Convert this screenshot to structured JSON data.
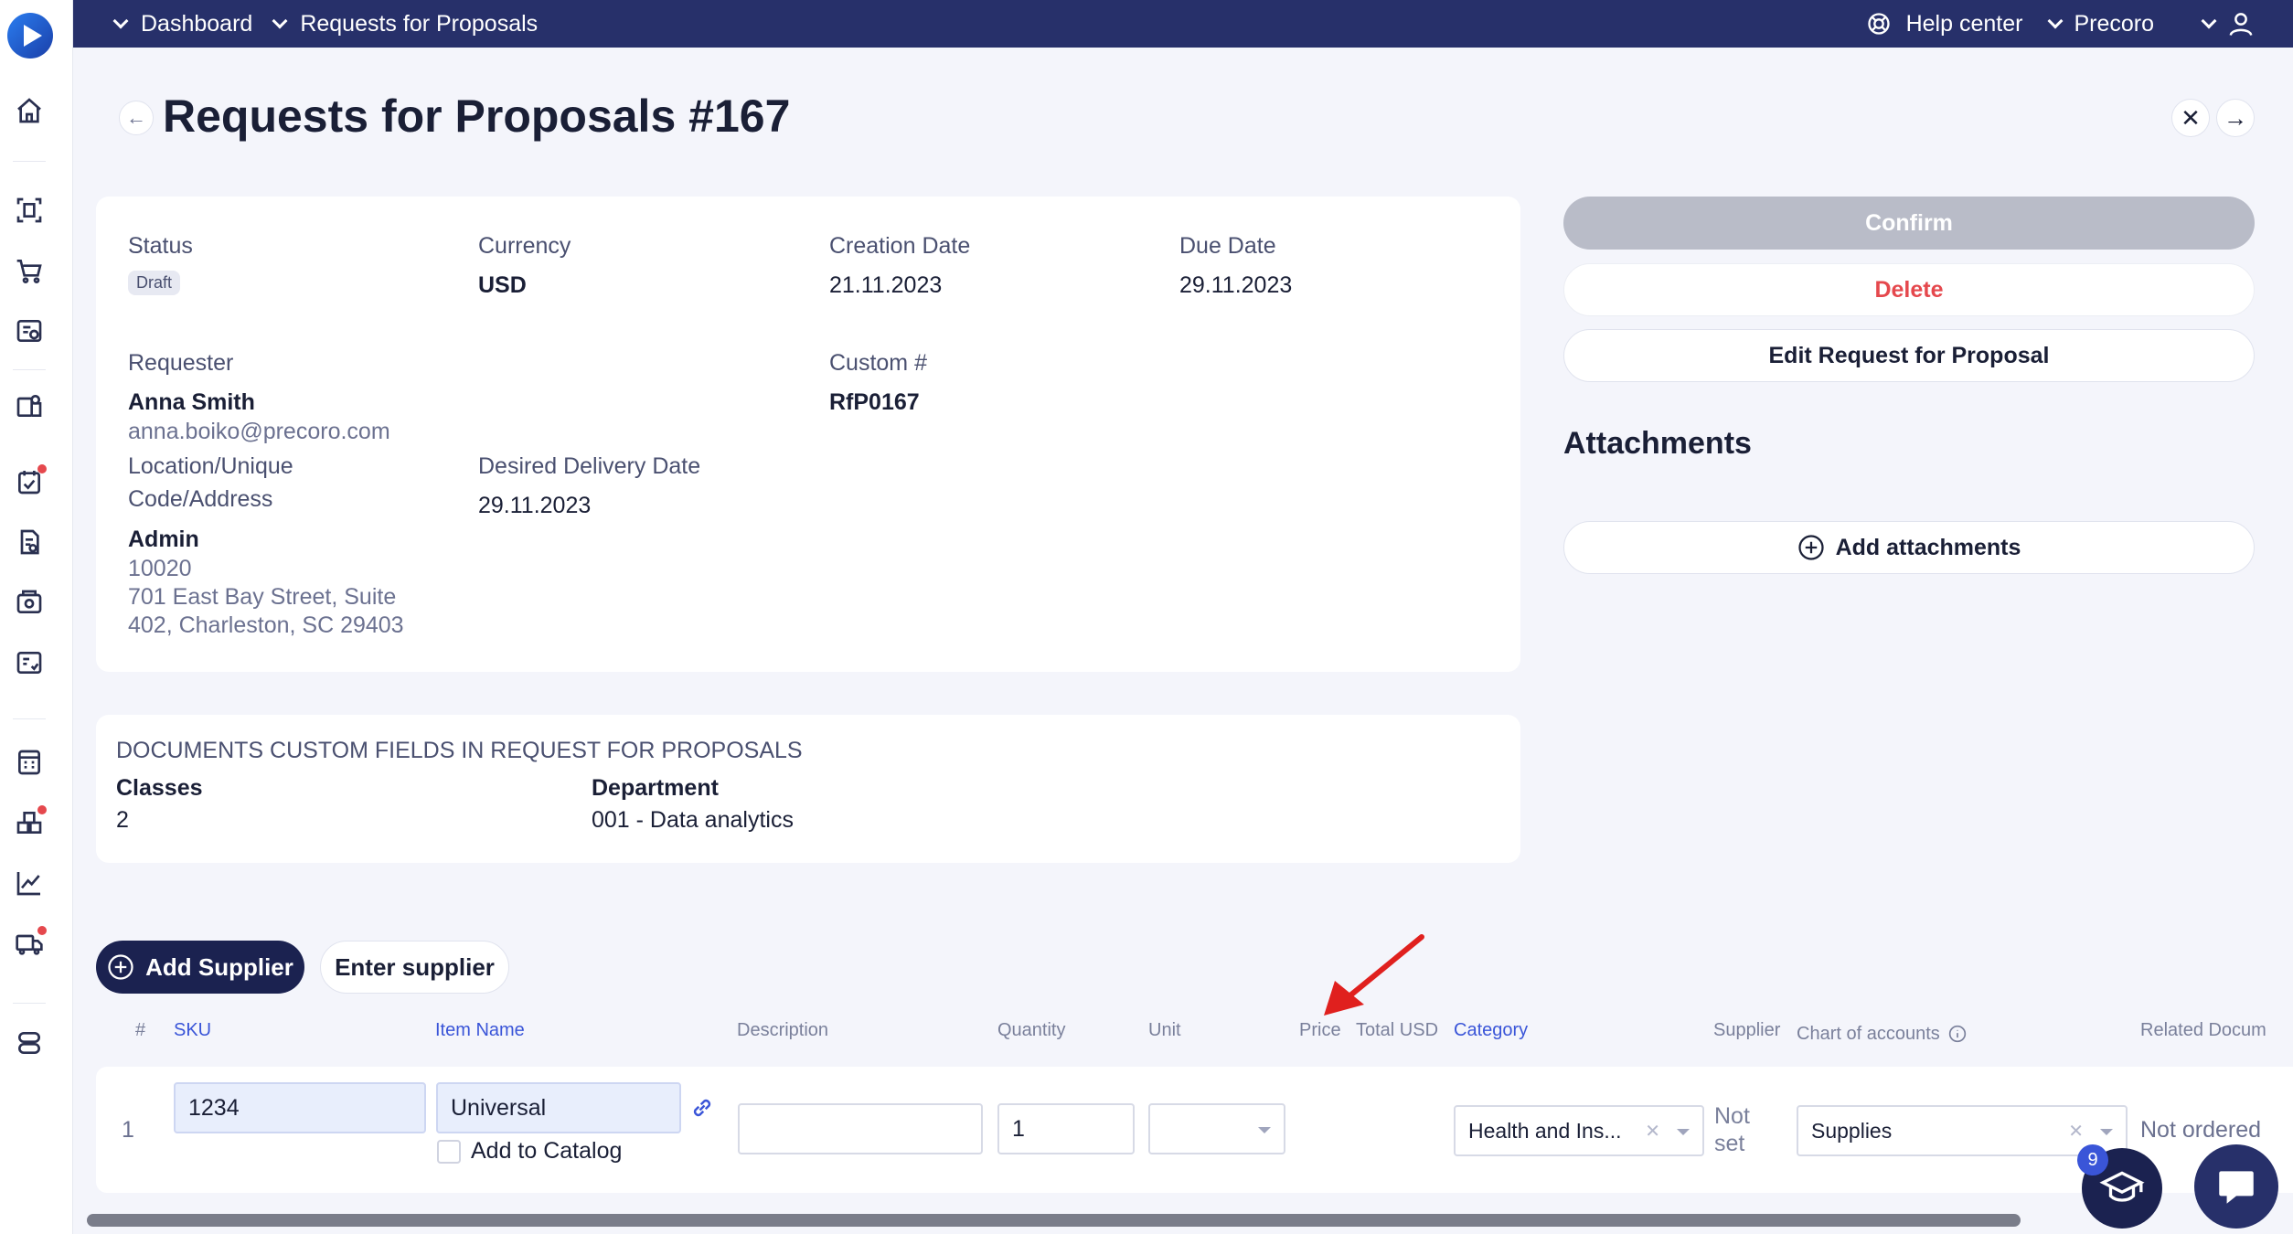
{
  "nav": {
    "breadcrumb_1": "Dashboard",
    "breadcrumb_2": "Requests for Proposals",
    "help": "Help center",
    "company": "Precoro"
  },
  "page": {
    "title": "Requests for Proposals #167"
  },
  "details": {
    "status_label": "Status",
    "status_value": "Draft",
    "currency_label": "Currency",
    "currency_value": "USD",
    "creation_label": "Creation Date",
    "creation_value": "21.11.2023",
    "due_label": "Due Date",
    "due_value": "29.11.2023",
    "requester_label": "Requester",
    "requester_name": "Anna Smith",
    "requester_email": "anna.boiko@precoro.com",
    "custom_label": "Custom #",
    "custom_value": "RfP0167",
    "location_label_1": "Location/Unique",
    "location_label_2": "Code/Address",
    "location_name": "Admin",
    "location_code": "10020",
    "location_addr_1": "701 East Bay Street, Suite",
    "location_addr_2": "402, Charleston, SC 29403",
    "delivery_label": "Desired Delivery Date",
    "delivery_value": "29.11.2023"
  },
  "custom_fields": {
    "heading": "DOCUMENTS CUSTOM FIELDS IN REQUEST FOR PROPOSALS",
    "classes_label": "Classes",
    "classes_value": "2",
    "department_label": "Department",
    "department_value": "001 - Data analytics"
  },
  "actions": {
    "confirm": "Confirm",
    "delete": "Delete",
    "edit": "Edit Request for Proposal",
    "attachments_title": "Attachments",
    "add_attachments": "Add attachments"
  },
  "supplier": {
    "add": "Add Supplier",
    "enter": "Enter supplier"
  },
  "table": {
    "headers": {
      "num": "#",
      "sku": "SKU",
      "item_name": "Item Name",
      "description": "Description",
      "quantity": "Quantity",
      "unit": "Unit",
      "price": "Price",
      "total": "Total USD",
      "category": "Category",
      "supplier": "Supplier",
      "chart": "Chart of accounts",
      "related": "Related Docum"
    },
    "row": {
      "num": "1",
      "sku": "1234",
      "item_name": "Universal",
      "add_to_catalog": "Add to Catalog",
      "description": "",
      "quantity": "1",
      "unit": "",
      "category": "Health and Ins...",
      "supplier_1": "Not",
      "supplier_2": "set",
      "chart": "Supplies",
      "related": "Not ordered"
    }
  },
  "help_badge": "9",
  "colors": {
    "topbar": "#27306a",
    "accent": "#3a55d8",
    "danger": "#e5484d",
    "dark_button": "#1b2250"
  }
}
